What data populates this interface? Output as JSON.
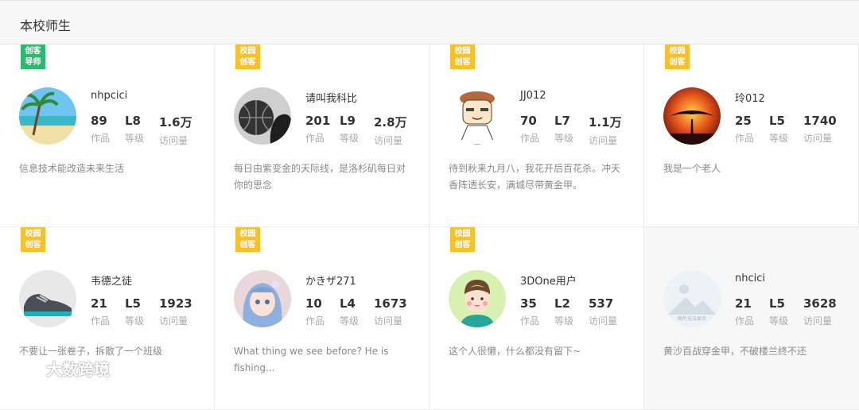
{
  "header": {
    "title": "本校师生"
  },
  "cards": [
    {
      "name": "nhpcici",
      "badge": "创客\n导师",
      "badge_color": "green",
      "stats": [
        {
          "value": "89",
          "label": "作品"
        },
        {
          "value": "L8",
          "label": "等级"
        },
        {
          "value": "1.6万",
          "label": "访问量"
        }
      ],
      "desc": "信息技术能改造未来生活",
      "avatar": "beach-avatar"
    },
    {
      "name": "请叫我科比",
      "badge": "校园\n创客",
      "badge_color": "yellow",
      "stats": [
        {
          "value": "201",
          "label": "作品"
        },
        {
          "value": "L9",
          "label": "等级"
        },
        {
          "value": "2.8万",
          "label": "访问量"
        }
      ],
      "desc": "每日由紫变金的天际线，是洛杉矶每日对你的思念",
      "avatar": "basketball-avatar"
    },
    {
      "name": "JJ012",
      "badge": "校园\n创客",
      "badge_color": "yellow",
      "stats": [
        {
          "value": "70",
          "label": "作品"
        },
        {
          "value": "L7",
          "label": "等级"
        },
        {
          "value": "1.1万",
          "label": "访问量"
        }
      ],
      "desc": "待到秋来九月八，我花开后百花杀。冲天香阵透长安，满城尽带黄金甲。",
      "avatar": "cartoon-man-avatar"
    },
    {
      "name": "玲012",
      "badge": "校园\n创客",
      "badge_color": "yellow",
      "stats": [
        {
          "value": "25",
          "label": "作品"
        },
        {
          "value": "L5",
          "label": "等级"
        },
        {
          "value": "1740",
          "label": "访问量"
        }
      ],
      "desc": "我是一个老人",
      "avatar": "sunset-tree-avatar"
    },
    {
      "name": "韦德之徒",
      "badge": "校园\n创客",
      "badge_color": "yellow",
      "stats": [
        {
          "value": "21",
          "label": "作品"
        },
        {
          "value": "L5",
          "label": "等级"
        },
        {
          "value": "1923",
          "label": "访问量"
        }
      ],
      "desc": "不要让一张卷子，拆散了一个班级",
      "avatar": "sneaker-avatar"
    },
    {
      "name": "かきザ271",
      "badge": "校园\n创客",
      "badge_color": "yellow",
      "stats": [
        {
          "value": "10",
          "label": "作品"
        },
        {
          "value": "L4",
          "label": "等级"
        },
        {
          "value": "1673",
          "label": "访问量"
        }
      ],
      "desc": "What thing we see before?   He is fishing...",
      "avatar": "anime-girl-avatar"
    },
    {
      "name": "3DOne用户",
      "badge": "校园\n创客",
      "badge_color": "yellow",
      "stats": [
        {
          "value": "35",
          "label": "作品"
        },
        {
          "value": "L2",
          "label": "等级"
        },
        {
          "value": "537",
          "label": "访问量"
        }
      ],
      "desc": "这个人很懒，什么都没有留下~",
      "avatar": "default-boy-avatar"
    },
    {
      "name": "nhcici",
      "badge": "",
      "badge_color": "",
      "stats": [
        {
          "value": "21",
          "label": "作品"
        },
        {
          "value": "L5",
          "label": "等级"
        },
        {
          "value": "3628",
          "label": "访问量"
        }
      ],
      "desc": "黄沙百战穿金甲，不破楼兰终不还",
      "avatar": "placeholder-image-avatar",
      "avatar_text": "图片无法显示"
    }
  ],
  "watermark": {
    "text": "大数跨境"
  }
}
